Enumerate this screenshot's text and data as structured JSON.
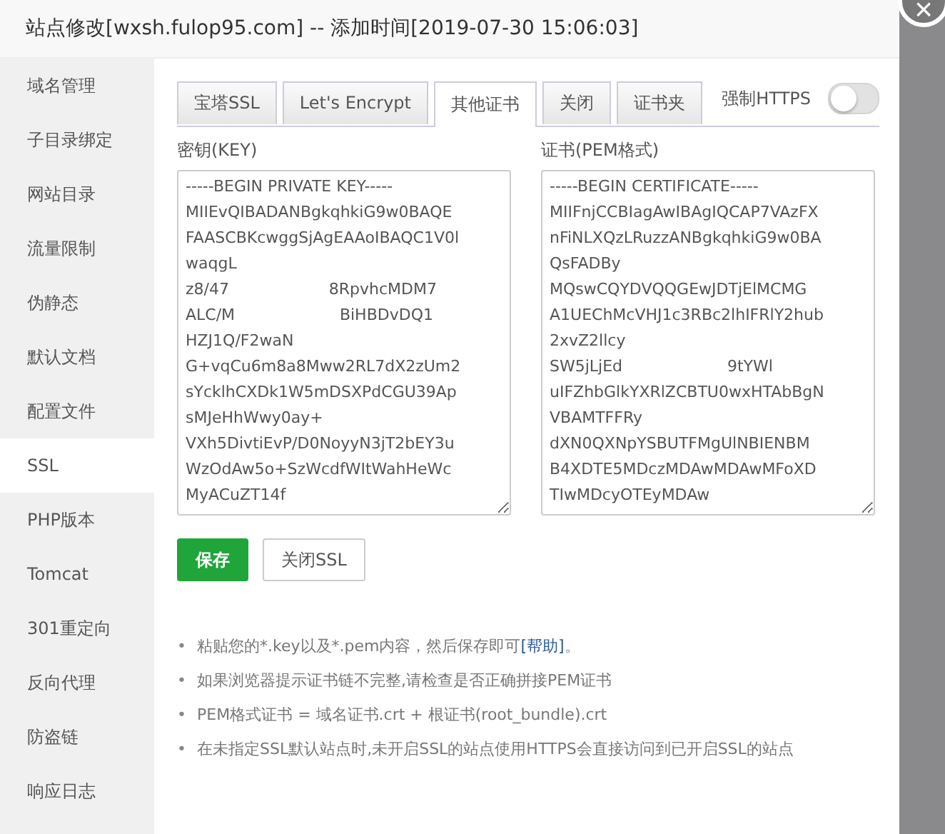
{
  "window": {
    "title": "站点修改[wxsh.fulop95.com] -- 添加时间[2019-07-30 15:06:03]",
    "close": "×"
  },
  "sidebar": {
    "items": [
      {
        "label": "域名管理",
        "selected": false
      },
      {
        "label": "子目录绑定",
        "selected": false
      },
      {
        "label": "网站目录",
        "selected": false
      },
      {
        "label": "流量限制",
        "selected": false
      },
      {
        "label": "伪静态",
        "selected": false
      },
      {
        "label": "默认文档",
        "selected": false
      },
      {
        "label": "配置文件",
        "selected": false
      },
      {
        "label": "SSL",
        "selected": true
      },
      {
        "label": "PHP版本",
        "selected": false
      },
      {
        "label": "Tomcat",
        "selected": false
      },
      {
        "label": "301重定向",
        "selected": false
      },
      {
        "label": "反向代理",
        "selected": false
      },
      {
        "label": "防盗链",
        "selected": false
      },
      {
        "label": "响应日志",
        "selected": false
      }
    ]
  },
  "tabs": [
    {
      "label": "宝塔SSL",
      "selected": false
    },
    {
      "label": "Let's Encrypt",
      "selected": false
    },
    {
      "label": "其他证书",
      "selected": true
    },
    {
      "label": "关闭",
      "selected": false
    },
    {
      "label": "证书夹",
      "selected": false
    }
  ],
  "force_https": {
    "label": "强制HTTPS",
    "on": false
  },
  "fields": [
    {
      "label": "密钥(KEY)",
      "value": "-----BEGIN PRIVATE KEY-----\nMIIEvQIBADANBgkqhkiG9w0BAQE\nFAASCBKcwggSjAgEAAoIBAQC1V0l\nwaqgL\nz8/47                    8RpvhcMDM7\nALC/M                     BiHBDvDQ1\nHZJ1Q/F2waN\nG+vqCu6m8a8Mww2RL7dX2zUm2\nsYcklhCXDk1W5mDSXPdCGU39Ap\nsMJeHhWwy0ay+\nVXh5DivtiEvP/D0NoyyN3jT2bEY3u\nWzOdAw5o+SzWcdfWItWahHeWc\nMyACuZT14f"
    },
    {
      "label": "证书(PEM格式)",
      "value": "-----BEGIN CERTIFICATE-----\nMIIFnjCCBIagAwIBAgIQCAP7VAzFX\nnFiNLXQzLRuzzANBgkqhkiG9w0BA\nQsFADBy\nMQswCQYDVQQGEwJDTjElMCMG\nA1UEChMcVHJ1c3RBc2lhIFRlY2hub\n2xvZ2llcy\nSW5jLjEd                     9tYWl\nuIFZhbGlkYXRlZCBTU0wxHTAbBgN\nVBAMTFFRy\ndXN0QXNpYSBUTFMgUlNBIENBM\nB4XDTE5MDczMDAwMDAwMFoXD\nTIwMDcyOTEyMDAw"
    }
  ],
  "buttons": [
    {
      "label": "保存",
      "kind": "primary"
    },
    {
      "label": "关闭SSL",
      "kind": "default"
    }
  ],
  "notes": [
    {
      "bullet": "•",
      "text": "粘贴您的*.key以及*.pem内容，然后保存即可",
      "link": "[帮助]",
      "after": "。"
    },
    {
      "bullet": "•",
      "text": "如果浏览器提示证书链不完整,请检查是否正确拼接PEM证书"
    },
    {
      "bullet": "•",
      "text": "PEM格式证书 = 域名证书.crt + 根证书(root_bundle).crt"
    },
    {
      "bullet": "•",
      "text": "在未指定SSL默认站点时,未开启SSL的站点使用HTTPS会直接访问到已开启SSL的站点"
    }
  ]
}
